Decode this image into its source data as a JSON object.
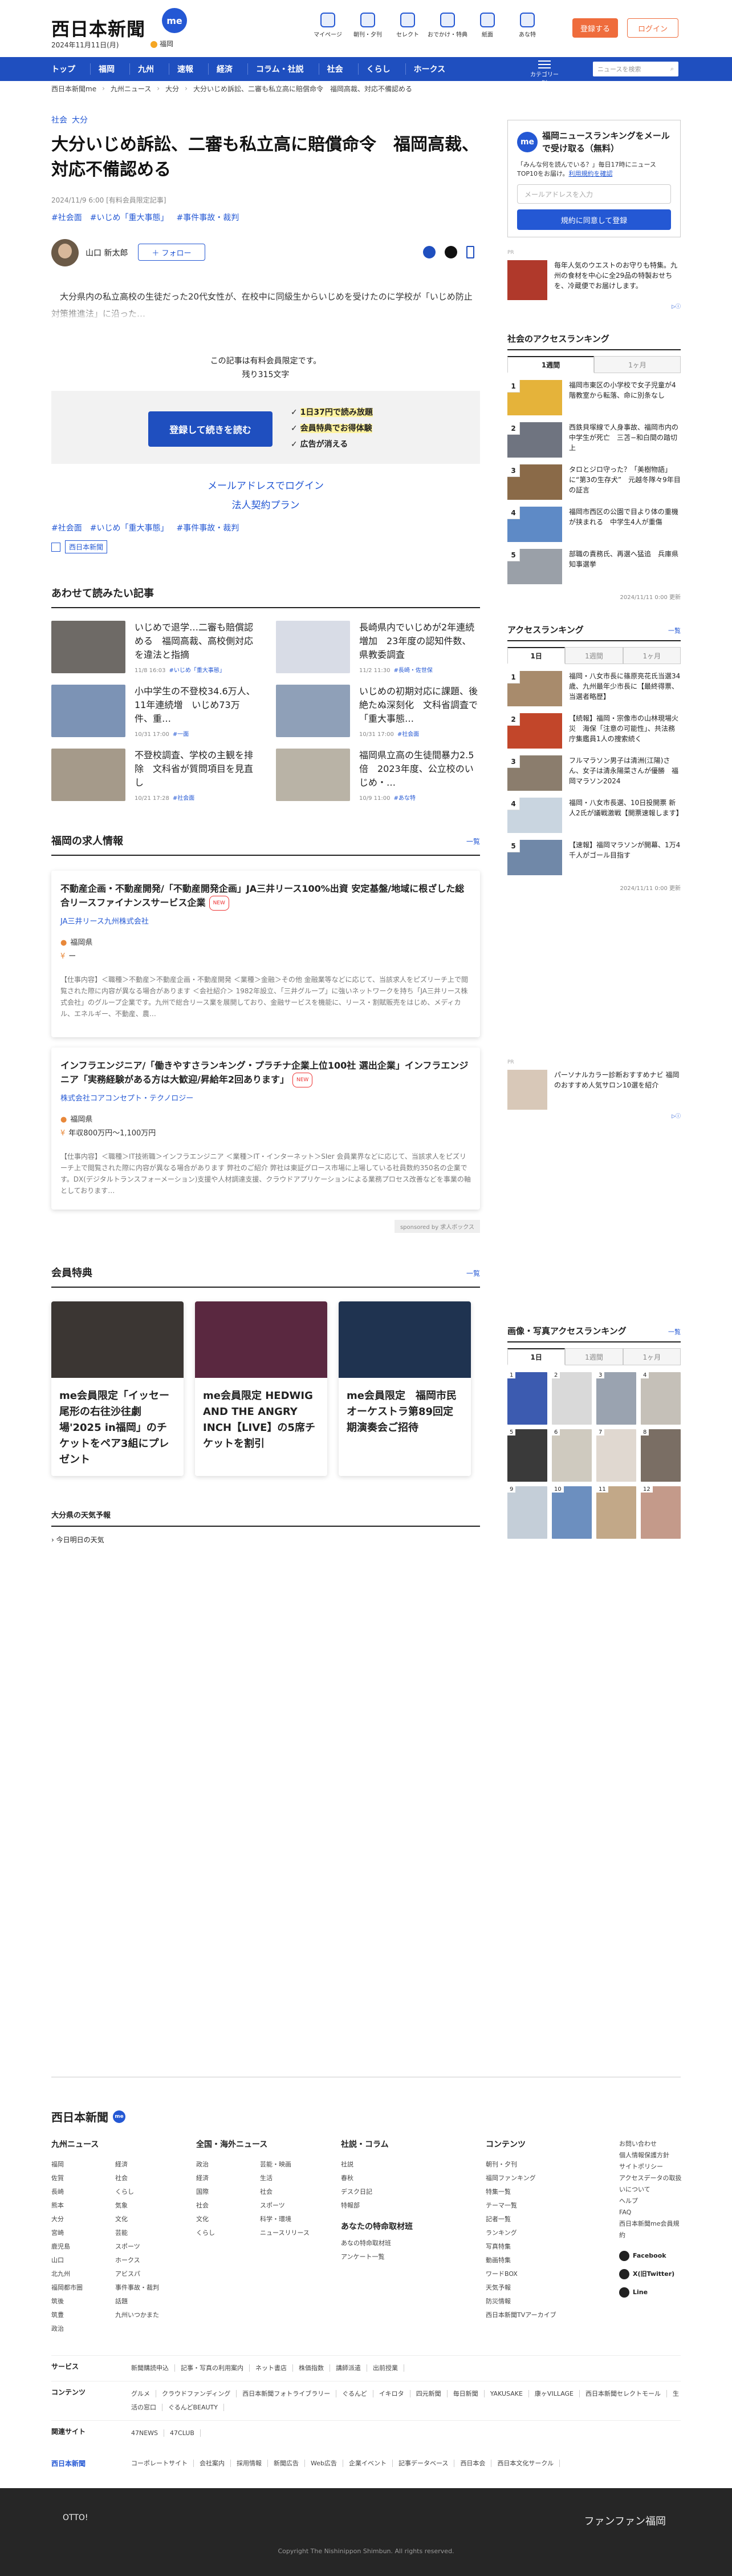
{
  "header": {
    "logo": "西日本新聞",
    "me": "me",
    "date": "2024年11月11日(月)",
    "weather_area": "福岡",
    "icons": [
      {
        "label": "マイページ",
        "icon": "person-icon"
      },
      {
        "label": "朝刊・夕刊",
        "icon": "newspaper-icon"
      },
      {
        "label": "セレクト",
        "icon": "select-icon"
      },
      {
        "label": "おでかけ・特典",
        "icon": "ticket-icon"
      },
      {
        "label": "紙面",
        "icon": "paper-icon"
      },
      {
        "label": "あな特",
        "icon": "chat-icon"
      }
    ],
    "register": "登録する",
    "login": "ログイン"
  },
  "nav": {
    "items": [
      "トップ",
      "福岡",
      "九州",
      "速報",
      "経済",
      "コラム・社説",
      "社会",
      "くらし",
      "ホークス"
    ],
    "menu": "カテゴリー別",
    "search_placeholder": "ニュースを検索"
  },
  "breadcrumb": [
    "西日本新聞me",
    "九州ニュース",
    "大分",
    "大分いじめ訴訟、二審も私立高に賠償命令　福岡高裁、対応不備認める"
  ],
  "article": {
    "categories": [
      "社会",
      "大分"
    ],
    "title": "大分いじめ訴訟、二審も私立高に賠償命令　福岡高裁、対応不備認める",
    "meta": "2024/11/9 6:00 [有料会員限定記事]",
    "tags": [
      "#社会面",
      "#いじめ「重大事態」",
      "#事件事故・裁判"
    ],
    "author": "山口 新太郎",
    "follow": "＋ フォロー",
    "lead": "大分県内の私立高校の生徒だった20代女性が、在校中に同級生からいじめを受けたのに学校が「いじめ防止対策推進法」に沿った…",
    "pay_note": "この記事は有料会員限定です。",
    "remaining": "残り315文字",
    "pay_button": "登録して続きを読む",
    "benefits": [
      "1日37円で読み放題",
      "会員特典でお得体験",
      "広告が消える"
    ],
    "mail_login": "メールアドレスでログイン",
    "corp_plan": "法人契約プラン",
    "provider": "西日本新聞"
  },
  "related": {
    "heading": "あわせて読みたい記事",
    "items": [
      {
        "title": "いじめで退学…二審も賠償認める　福岡高裁、高校側対応を違法と指摘",
        "time": "11/8 16:03",
        "tag": "#いじめ「重大事態」",
        "color": "#6e6a66"
      },
      {
        "title": "長崎県内でいじめが2年連続増加　23年度の認知件数、県教委調査",
        "time": "11/2 11:30",
        "tag": "#長崎・佐世保",
        "color": "#d8dce6"
      },
      {
        "title": "小中学生の不登校34.6万人、11年連続増　いじめ73万件、重…",
        "time": "10/31 17:00",
        "tag": "#一面",
        "color": "#7c93b5"
      },
      {
        "title": "いじめの初期対応に課題、後絶たぬ深刻化　文科省調査で「重大事態…",
        "time": "10/31 17:00",
        "tag": "#社会面",
        "color": "#8fa0b8"
      },
      {
        "title": "不登校調査、学校の主観を排除　文科省が質問項目を見直し",
        "time": "10/21 17:28",
        "tag": "#社会面",
        "color": "#a59a8a"
      },
      {
        "title": "福岡県立高の生徒間暴力2.5倍　2023年度、公立校のいじめ・…",
        "time": "10/9 11:00",
        "tag": "#あな特",
        "color": "#b9b3a6"
      }
    ]
  },
  "jobs": {
    "heading": "福岡の求人情報",
    "more": "一覧",
    "items": [
      {
        "title": "不動産企画・不動産開発/「不動産開発企画」JA三井リース100%出資 安定基盤/地域に根ざした総合リースファイナンスサービス企業",
        "new": "NEW",
        "company": "JA三井リース九州株式会社",
        "location": "福岡県",
        "salary": "ー",
        "desc": "【仕事内容】＜職種＞不動産＞不動産企画・不動産開発 ＜業種＞金融＞その他 金融業等などに応じて、当該求人をピズリーチ上で閲覧された際に内容が異なる場合があります ＜会社紹介＞ 1982年設立、「三井グループ」に強いネットワークを持ち「JA三井リース株式会社」のグループ企業です。九州で総合リース業を展開しており、金融サービスを機能に、リース・割賦販売をはじめ、メディカル、エネルギー、不動産、農…"
      },
      {
        "title": "インフラエンジニア/「働きやすさランキング・プラチナ企業上位100社 選出企業」インフラエンジニア「実務経験がある方は大歓迎/昇給年2回あります」",
        "new": "NEW",
        "company": "株式会社コアコンセプト・テクノロジー",
        "location": "福岡県",
        "salary": "年収800万円〜1,100万円",
        "desc": "【仕事内容】＜職種＞IT技術職＞インフラエンジニア ＜業種＞IT・インターネット＞SIer 会員業界などに応じて、当該求人をピズリーチ上で閲覧された際に内容が異なる場合があります 弊社のご紹介 弊社は東証グロース市場に上場している社員数約350名の企業です。DX(デジタルトランスフォーメーション)支援や人材調達支援、クラウドアプリケーションによる業務プロセス改善などを事業の軸としております…"
      }
    ],
    "sponsor": "sponsored by 求人ボックス"
  },
  "perks": {
    "heading": "会員特典",
    "more": "一覧",
    "items": [
      {
        "title": "me会員限定「イッセー尾形の右往沙往劇場'2025 in福岡」のチケットをペア3組にプレゼント",
        "color": "#3b3633"
      },
      {
        "title": "me会員限定 HEDWIG AND THE ANGRY INCH【LIVE】の5席チケットを割引",
        "color": "#5a2840"
      },
      {
        "title": "me会員限定　福岡市民オーケストラ第89回定期演奏会ご招待",
        "color": "#1f3350"
      }
    ]
  },
  "weather": {
    "heading": "大分県の天気予報",
    "row": "今日明日の天気"
  },
  "side": {
    "promo": {
      "me": "me",
      "title": "福岡ニュースランキングをメールで受け取る（無料）",
      "desc": "「みんな何を読んでいる？」毎日17時にニュースTOP10をお届け。",
      "terms": "利用規約を確認",
      "placeholder": "メールアドレスを入力",
      "button": "規約に同意して登録"
    },
    "ad_label": "PR",
    "ad1": "毎年人気のウエストのお守りも特集。九州の食材を中心に全29品の特製おせちを、冷蔵便でお届けします。",
    "access": {
      "heading": "社会のアクセスランキング",
      "tabs": [
        "1週間",
        "1ヶ月"
      ],
      "items": [
        {
          "n": "1",
          "title": "福岡市東区の小学校で女子児童が4階教室から転落、命に別条なし",
          "color": "#e5b33a"
        },
        {
          "n": "2",
          "title": "西鉄貝塚線で人身事故、福岡市内の中学生が死亡　三苫−和白間の踏切上",
          "color": "#6f7480"
        },
        {
          "n": "3",
          "title": "タロとジロ守った？「美樹物語」に“第3の生存犬”　元越冬隊々9年目の証言",
          "color": "#8a6a48"
        },
        {
          "n": "4",
          "title": "福岡市西区の公園で目より体の重機が挟まれる　中学生4人が重傷",
          "color": "#5e8ac6"
        },
        {
          "n": "5",
          "title": "部職の責務氏、再選へ猛追　兵庫県知事選挙",
          "color": "#9aa0a8"
        }
      ],
      "updated": "2024/11/11 0:00 更新"
    },
    "access2": {
      "heading": "アクセスランキング",
      "more": "一覧",
      "tabs": [
        "1日",
        "1週間",
        "1ヶ月"
      ],
      "items": [
        {
          "n": "1",
          "title": "福岡・八女市長に篠原亮花氏当選34歳、九州最年少市長に【最終得票、当選者略歴】",
          "color": "#a88b6c"
        },
        {
          "n": "2",
          "title": "【続報】福岡・宗像市の山林現場火災　海保「注意の可能性」、共法務庁集鑑員1人の捜索続く",
          "color": "#c2462a"
        },
        {
          "n": "3",
          "title": "フルマラソン男子は清洲(江陽)さん、女子は清永陽菜さんが優勝　福岡マラソン2024",
          "color": "#8b7d6d"
        },
        {
          "n": "4",
          "title": "福岡・八女市長選、10日投開票 新人2氏が議戦激戦【開票速報します】",
          "color": "#c9d5e0"
        },
        {
          "n": "5",
          "title": "【速報】福岡マラソンが開幕、1万4千人がゴール目指す",
          "color": "#7088a8"
        }
      ],
      "updated": "2024/11/11 0:00 更新"
    },
    "ad2": "パーソナルカラー診断おすすめナビ 福岡のおすすめ人気サロン10選を紹介",
    "photo": {
      "heading": "画像・写真アクセスランキング",
      "more": "一覧",
      "tabs": [
        "1日",
        "1週間",
        "1ヶ月"
      ],
      "cells": [
        "#3c5bb0",
        "#d9d9d9",
        "#9aa3b0",
        "#c5c0b8",
        "#3a3a3a",
        "#cfcabf",
        "#e0d8d0",
        "#7a6e64",
        "#c4ced8",
        "#6c8fbf",
        "#c2a888",
        "#c49a8a"
      ]
    }
  },
  "footer": {
    "logo": "西日本新聞",
    "me": "me",
    "cols": [
      {
        "h": "九州ニュース",
        "items": [
          "福岡",
          "佐賀",
          "長崎",
          "熊本",
          "大分",
          "宮崎",
          "鹿児島",
          "山口",
          "北九州",
          "福岡都市圏",
          "筑後",
          "筑豊",
          "政治",
          "経済",
          "社会",
          "くらし",
          "気象",
          "文化",
          "芸能",
          "スポーツ",
          "ホークス",
          "アビスパ",
          "事件事故・裁判",
          "話題",
          "九州いつかまた"
        ]
      },
      {
        "h": "全国・海外ニュース",
        "items": [
          "政治",
          "経済",
          "国際",
          "社会",
          "文化",
          "くらし",
          "芸能・映画",
          "生活",
          "社会",
          "スポーツ",
          "科学・環境",
          "ニュースリリース"
        ]
      },
      {
        "h": "社説・コラム",
        "items": [
          "社説",
          "春秋",
          "デスク日記",
          "特報部"
        ]
      },
      {
        "h": "コンテンツ",
        "items": [
          "朝刊・夕刊",
          "福岡ファンキング",
          "特集一覧",
          "テーマ一覧",
          "記者一覧",
          "ランキング",
          "写真特集",
          "動画特集",
          "ワードBOX",
          "天気予報",
          "防災情報",
          "西日本新聞TVアーカイブ"
        ]
      }
    ],
    "sub_heading": "あなたの特命取材班",
    "sub_items": [
      "あなの特命取材班",
      "アンケート一覧"
    ],
    "info": [
      "お問い合わせ",
      "個人情報保護方針",
      "サイトポリシー",
      "アクセスデータの取扱いについて",
      "ヘルプ",
      "FAQ",
      "西日本新聞me会員規約"
    ],
    "social": [
      "Facebook",
      "X(旧Twitter)",
      "Line"
    ],
    "rows": [
      {
        "label": "サービス",
        "items": [
          "新聞購読申込",
          "記事・写真の利用案内",
          "ネット書店",
          "株価指数",
          "講師派遣",
          "出前授業"
        ]
      },
      {
        "label": "コンテンツ",
        "items": [
          "グルメ",
          "クラウドファンディング",
          "西日本新聞フォトライブラリー",
          "ぐるんど",
          "イキロタ",
          "四元新聞",
          "毎日新聞",
          "YAKUSAKE",
          "康ヶVILLAGE",
          "西日本新聞セレクトモール",
          "生活の窓口",
          "ぐるんどBEAUTY"
        ]
      },
      {
        "label": "関連サイト",
        "items": [
          "47NEWS",
          "47CLUB"
        ]
      }
    ],
    "corp_label": "西日本新聞",
    "corp": [
      "コーポレートサイト",
      "会社案内",
      "採用情報",
      "新聞広告",
      "Web広告",
      "企業イベント",
      "記事データベース",
      "西日本会",
      "西日本文化サークル"
    ],
    "otto": "OTTO!",
    "ff": "ファンファン福岡",
    "copyright": "Copyright The Nishinippon Shimbun. All rights reserved."
  }
}
